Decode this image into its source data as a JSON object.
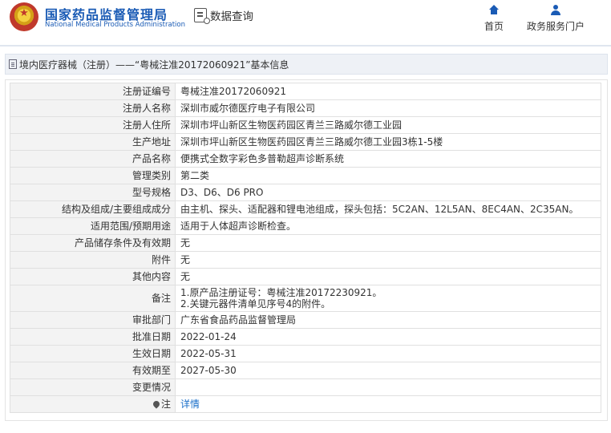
{
  "header": {
    "logo_cn": "国家药品监督管理局",
    "logo_en": "National Medical Products Administration",
    "page_name": "数据查询",
    "nav": [
      {
        "label": "首页",
        "icon": "home-icon"
      },
      {
        "label": "政务服务门户",
        "icon": "user-icon"
      }
    ]
  },
  "title": {
    "text": "境内医疗器械（注册）——“粤械注准20172060921”基本信息"
  },
  "rows": [
    {
      "label": "注册证编号",
      "value": "粤械注准20172060921"
    },
    {
      "label": "注册人名称",
      "value": "深圳市威尔德医疗电子有限公司"
    },
    {
      "label": "注册人住所",
      "value": "深圳市坪山新区生物医药园区青兰三路威尔德工业园"
    },
    {
      "label": "生产地址",
      "value": "深圳市坪山新区生物医药园区青兰三路威尔德工业园3栋1-5楼"
    },
    {
      "label": "产品名称",
      "value": "便携式全数字彩色多普勒超声诊断系统"
    },
    {
      "label": "管理类别",
      "value": "第二类"
    },
    {
      "label": "型号规格",
      "value": "D3、D6、D6 PRO"
    },
    {
      "label": "结构及组成/主要组成成分",
      "value": "由主机、探头、适配器和锂电池组成，探头包括：5C2AN、12L5AN、8EC4AN、2C35AN。"
    },
    {
      "label": "适用范围/预期用途",
      "value": "适用于人体超声诊断检查。"
    },
    {
      "label": "产品储存条件及有效期",
      "value": "无"
    },
    {
      "label": "附件",
      "value": "无"
    },
    {
      "label": "其他内容",
      "value": "无"
    },
    {
      "label": "备注",
      "line1": "1.原产品注册证号：粤械注准20172230921。",
      "line2": "2.关键元器件清单见序号4的附件。"
    },
    {
      "label": "审批部门",
      "value": "广东省食品药品监督管理局"
    },
    {
      "label": "批准日期",
      "value": "2022-01-24"
    },
    {
      "label": "生效日期",
      "value": "2022-05-31"
    },
    {
      "label": "有效期至",
      "value": "2027-05-30"
    },
    {
      "label": "变更情况",
      "value": ""
    },
    {
      "label": "注",
      "value": "详情",
      "icon": "pin-icon"
    }
  ]
}
